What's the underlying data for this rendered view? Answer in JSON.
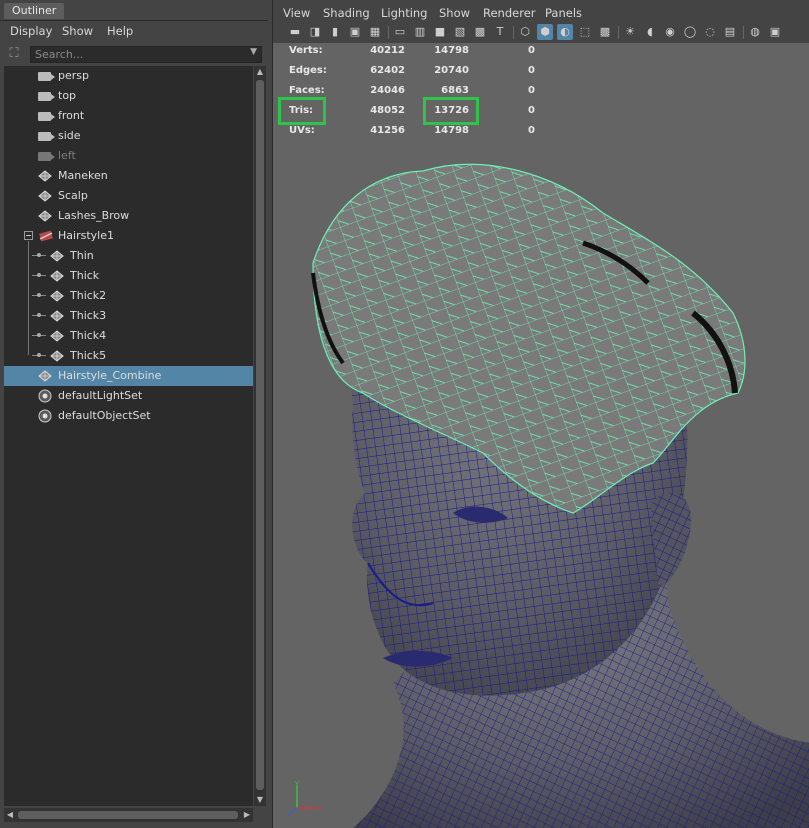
{
  "outliner": {
    "tab_title": "Outliner",
    "menus": [
      "Display",
      "Show",
      "Help"
    ],
    "search_placeholder": "Search...",
    "items": [
      {
        "label": "persp",
        "icon": "camera-icon",
        "depth": 0,
        "selected": false,
        "dim": false
      },
      {
        "label": "top",
        "icon": "camera-icon",
        "depth": 0,
        "selected": false,
        "dim": false
      },
      {
        "label": "front",
        "icon": "camera-icon",
        "depth": 0,
        "selected": false,
        "dim": false
      },
      {
        "label": "side",
        "icon": "camera-icon",
        "depth": 0,
        "selected": false,
        "dim": false
      },
      {
        "label": "left",
        "icon": "camera-icon",
        "depth": 0,
        "selected": false,
        "dim": true
      },
      {
        "label": "Maneken",
        "icon": "mesh-icon",
        "depth": 0,
        "selected": false,
        "dim": false
      },
      {
        "label": "Scalp",
        "icon": "mesh-icon",
        "depth": 0,
        "selected": false,
        "dim": false
      },
      {
        "label": "Lashes_Brow",
        "icon": "mesh-icon",
        "depth": 0,
        "selected": false,
        "dim": false
      },
      {
        "label": "Hairstyle1",
        "icon": "group-icon",
        "depth": 0,
        "selected": false,
        "dim": false,
        "expanded": true
      },
      {
        "label": "Thin",
        "icon": "mesh-icon",
        "depth": 1,
        "selected": false,
        "dim": false
      },
      {
        "label": "Thick",
        "icon": "mesh-icon",
        "depth": 1,
        "selected": false,
        "dim": false
      },
      {
        "label": "Thick2",
        "icon": "mesh-icon",
        "depth": 1,
        "selected": false,
        "dim": false
      },
      {
        "label": "Thick3",
        "icon": "mesh-icon",
        "depth": 1,
        "selected": false,
        "dim": false
      },
      {
        "label": "Thick4",
        "icon": "mesh-icon",
        "depth": 1,
        "selected": false,
        "dim": false
      },
      {
        "label": "Thick5",
        "icon": "mesh-icon",
        "depth": 1,
        "selected": false,
        "dim": false
      },
      {
        "label": "Hairstyle_Combine",
        "icon": "mesh-icon",
        "depth": 0,
        "selected": true,
        "dim": false
      },
      {
        "label": "defaultLightSet",
        "icon": "set-icon",
        "depth": 0,
        "selected": false,
        "dim": false
      },
      {
        "label": "defaultObjectSet",
        "icon": "set-icon",
        "depth": 0,
        "selected": false,
        "dim": false
      }
    ]
  },
  "viewport": {
    "menus": [
      "View",
      "Shading",
      "Lighting",
      "Show",
      "Renderer",
      "Panels"
    ],
    "toolbar_icons": [
      "camera-icon",
      "camera-attributes-icon",
      "bookmark-icon",
      "image-plane-icon",
      "grid-icon",
      "film-gate-icon",
      "resolution-gate-icon",
      "gate-mask-icon",
      "field-chart-icon",
      "safe-action-icon",
      "safe-title-icon",
      "wireframe-icon",
      "smooth-shade-icon",
      "wireframe-on-shaded-icon",
      "xray-joints-icon",
      "textured-icon",
      "use-all-lights-icon",
      "shadows-icon",
      "screen-space-ao-icon",
      "motion-blur-icon",
      "anti-aliasing-icon",
      "depth-of-field-icon",
      "isolate-select-icon",
      "xray-icon"
    ],
    "hud": {
      "rows": [
        {
          "label": "Verts:",
          "v1": "40212",
          "v2": "14798",
          "v3": "0"
        },
        {
          "label": "Edges:",
          "v1": "62402",
          "v2": "20740",
          "v3": "0"
        },
        {
          "label": "Faces:",
          "v1": "24046",
          "v2": "6863",
          "v3": "0"
        },
        {
          "label": "Tris:",
          "v1": "48052",
          "v2": "13726",
          "v3": "0"
        },
        {
          "label": "UVs:",
          "v1": "41256",
          "v2": "14798",
          "v3": "0"
        }
      ],
      "highlighted_row": "Tris:",
      "highlight_color": "#2ec44a"
    },
    "colors": {
      "background": "#646464",
      "head_wire": "#1a1a8c",
      "hair_wire": "#6ef0b4",
      "selection": "#5285a6"
    }
  }
}
